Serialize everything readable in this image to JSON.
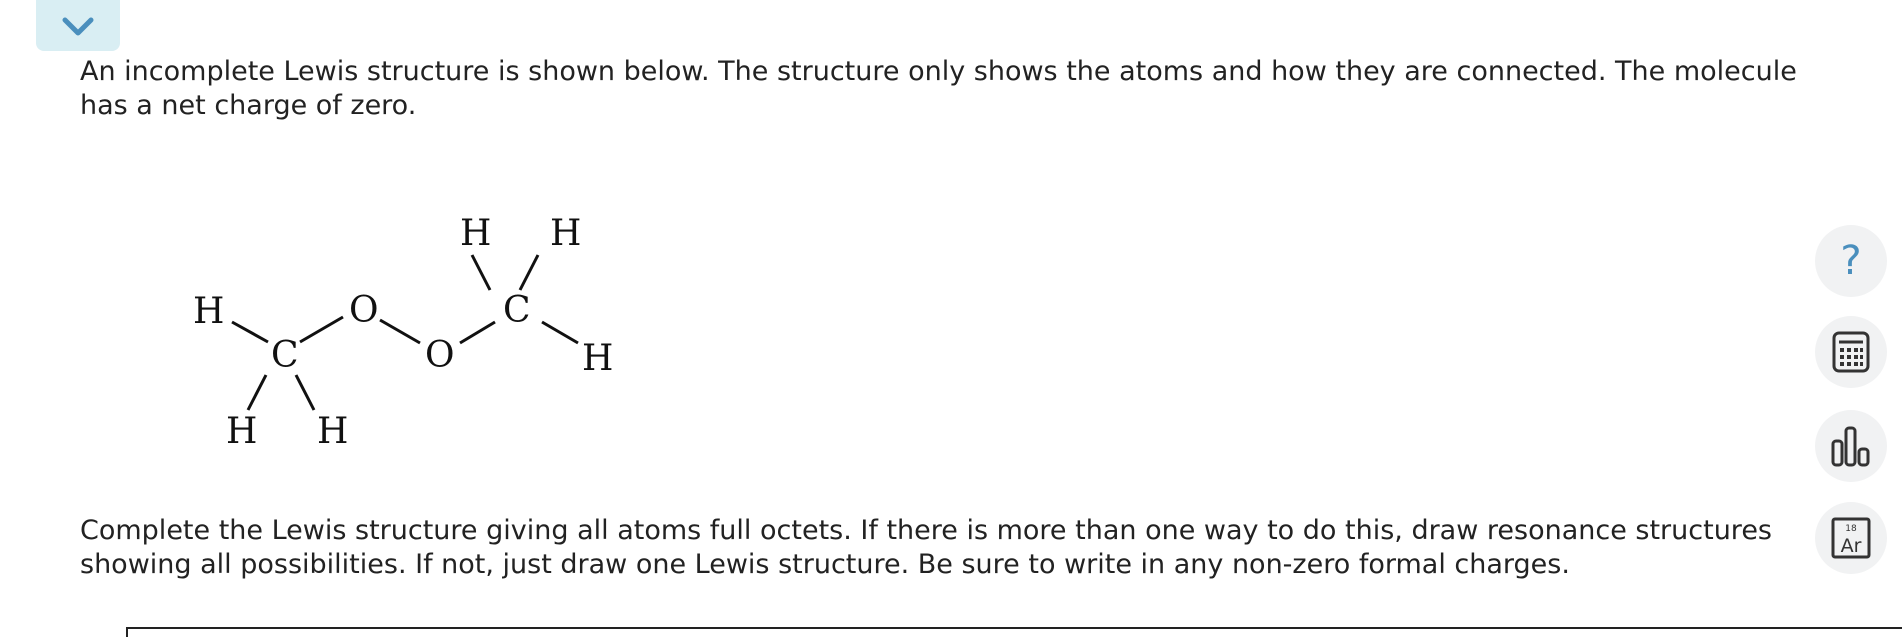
{
  "toggle": {
    "icon": "chevron-down-icon"
  },
  "question": {
    "intro": "An incomplete Lewis structure is shown below. The structure only shows the atoms and how they are connected. The molecule has a net charge of zero.",
    "instructions": "Complete the Lewis structure giving all atoms full octets. If there is more than one way to do this, draw resonance structures showing all possibilities. If not, just draw one Lewis structure. Be sure to write in any non-zero formal charges."
  },
  "molecule": {
    "atoms": {
      "h_left": "H",
      "c_left": "C",
      "h_bottom_left": "H",
      "h_bottom_right": "H",
      "o_upper": "O",
      "o_lower": "O",
      "c_right": "C",
      "h_top_left": "H",
      "h_top_right": "H",
      "h_right": "H"
    }
  },
  "sidebar_tools": {
    "help_label": "?",
    "help_icon": "question-mark-icon",
    "calc_icon": "calculator-icon",
    "chart_icon": "bar-chart-icon",
    "ptable_icon": "periodic-table-icon",
    "ptable_number": "18",
    "ptable_symbol": "Ar"
  },
  "colors": {
    "accent": "#4a8fbd",
    "tab_bg": "#d9eef3",
    "tool_bg": "#f1f2f3"
  }
}
